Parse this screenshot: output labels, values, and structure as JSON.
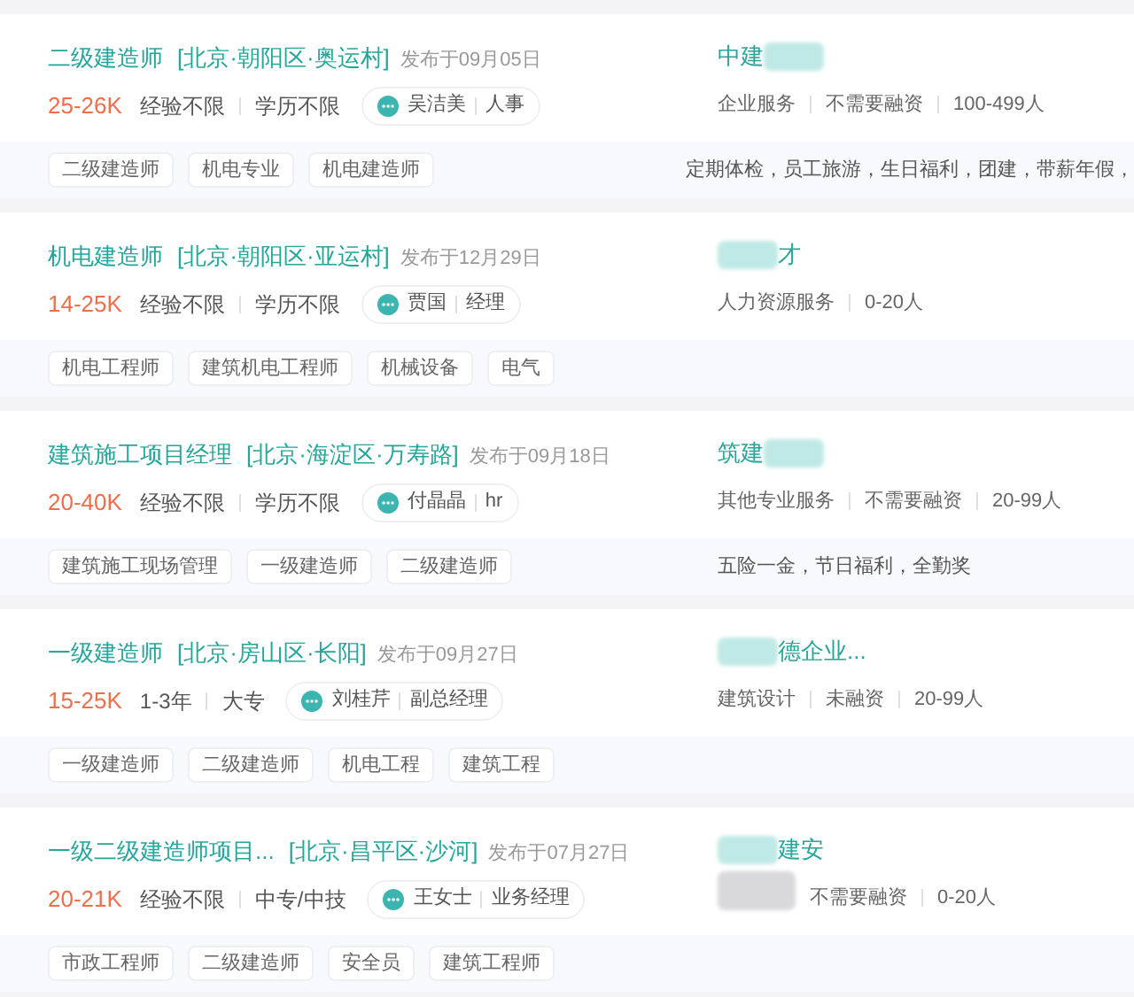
{
  "jobs": [
    {
      "title": "二级建造师",
      "location": "[北京·朝阳区·奥运村]",
      "posted": "发布于09月05日",
      "salary": "25-26K",
      "requirements": [
        "经验不限",
        "学历不限"
      ],
      "recruiter": {
        "name": "吴洁美",
        "position": "人事"
      },
      "company": [
        {
          "kind": "text",
          "text": "中建"
        },
        {
          "kind": "blur"
        }
      ],
      "company_info": [
        {
          "kind": "text",
          "text": "企业服务"
        },
        {
          "kind": "text",
          "text": "不需要融资"
        },
        {
          "kind": "text",
          "text": "100-499人"
        }
      ],
      "tags": [
        "二级建造师",
        "机电专业",
        "机电建造师"
      ],
      "benefits": "定期体检，员工旅游，生日福利，团建，带薪年假，"
    },
    {
      "title": "机电建造师",
      "location": "[北京·朝阳区·亚运村]",
      "posted": "发布于12月29日",
      "salary": "14-25K",
      "requirements": [
        "经验不限",
        "学历不限"
      ],
      "recruiter": {
        "name": "贾国",
        "position": "经理"
      },
      "company": [
        {
          "kind": "blur"
        },
        {
          "kind": "text",
          "text": "才"
        }
      ],
      "company_info": [
        {
          "kind": "text",
          "text": "人力资源服务"
        },
        {
          "kind": "text",
          "text": "0-20人"
        }
      ],
      "tags": [
        "机电工程师",
        "建筑机电工程师",
        "机械设备",
        "电气"
      ]
    },
    {
      "title": "建筑施工项目经理",
      "location": "[北京·海淀区·万寿路]",
      "posted": "发布于09月18日",
      "salary": "20-40K",
      "requirements": [
        "经验不限",
        "学历不限"
      ],
      "recruiter": {
        "name": "付晶晶",
        "position": "hr"
      },
      "company": [
        {
          "kind": "text",
          "text": "筑建"
        },
        {
          "kind": "blur"
        }
      ],
      "company_info": [
        {
          "kind": "text",
          "text": "其他专业服务"
        },
        {
          "kind": "text",
          "text": "不需要融资"
        },
        {
          "kind": "text",
          "text": "20-99人"
        }
      ],
      "tags": [
        "建筑施工现场管理",
        "一级建造师",
        "二级建造师"
      ],
      "benefits": "五险一金，节日福利，全勤奖"
    },
    {
      "title": "一级建造师",
      "location": "[北京·房山区·长阳]",
      "posted": "发布于09月27日",
      "salary": "15-25K",
      "requirements": [
        "1-3年",
        "大专"
      ],
      "recruiter": {
        "name": "刘桂芹",
        "position": "副总经理"
      },
      "company": [
        {
          "kind": "blur"
        },
        {
          "kind": "text",
          "text": "德企业..."
        }
      ],
      "company_info": [
        {
          "kind": "text",
          "text": "建筑设计"
        },
        {
          "kind": "text",
          "text": "未融资"
        },
        {
          "kind": "text",
          "text": "20-99人"
        }
      ],
      "tags": [
        "一级建造师",
        "二级建造师",
        "机电工程",
        "建筑工程"
      ]
    },
    {
      "title": "一级二级建造师项目...",
      "location": "[北京·昌平区·沙河]",
      "posted": "发布于07月27日",
      "salary": "20-21K",
      "requirements": [
        "经验不限",
        "中专/中技"
      ],
      "recruiter": {
        "name": "王女士",
        "position": "业务经理"
      },
      "company": [
        {
          "kind": "blur"
        },
        {
          "kind": "text",
          "text": "建安"
        }
      ],
      "company_info": [
        {
          "kind": "blur"
        },
        {
          "kind": "text",
          "text": "不需要融资"
        },
        {
          "kind": "text",
          "text": "0-20人"
        }
      ],
      "tags": [
        "市政工程师",
        "二级建造师",
        "安全员",
        "建筑工程师"
      ]
    }
  ]
}
